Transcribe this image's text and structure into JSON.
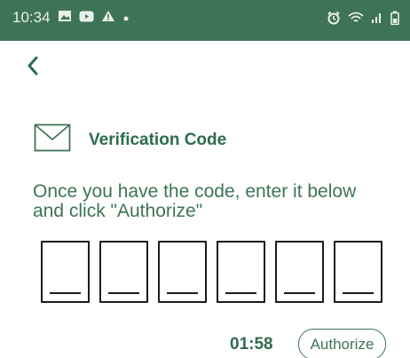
{
  "status_bar": {
    "time": "10:34",
    "left_icons": [
      "image-icon",
      "youtube-icon",
      "warning-icon",
      "dot-icon"
    ],
    "right_icons": [
      "alarm-icon",
      "wifi-icon",
      "signal-icon",
      "battery-icon"
    ],
    "background": "#3e7455"
  },
  "nav": {
    "back_icon": "chevron-left-icon"
  },
  "header": {
    "icon": "mail-icon",
    "title": "Verification Code"
  },
  "instructions": "Once you have the code, enter it below and click \"Authorize\"",
  "code_inputs": [
    "",
    "",
    "",
    "",
    "",
    ""
  ],
  "footer": {
    "timer": "01:58",
    "authorize_label": "Authorize"
  },
  "colors": {
    "accent": "#3e7455",
    "text_dark": "#2f6b4f"
  }
}
